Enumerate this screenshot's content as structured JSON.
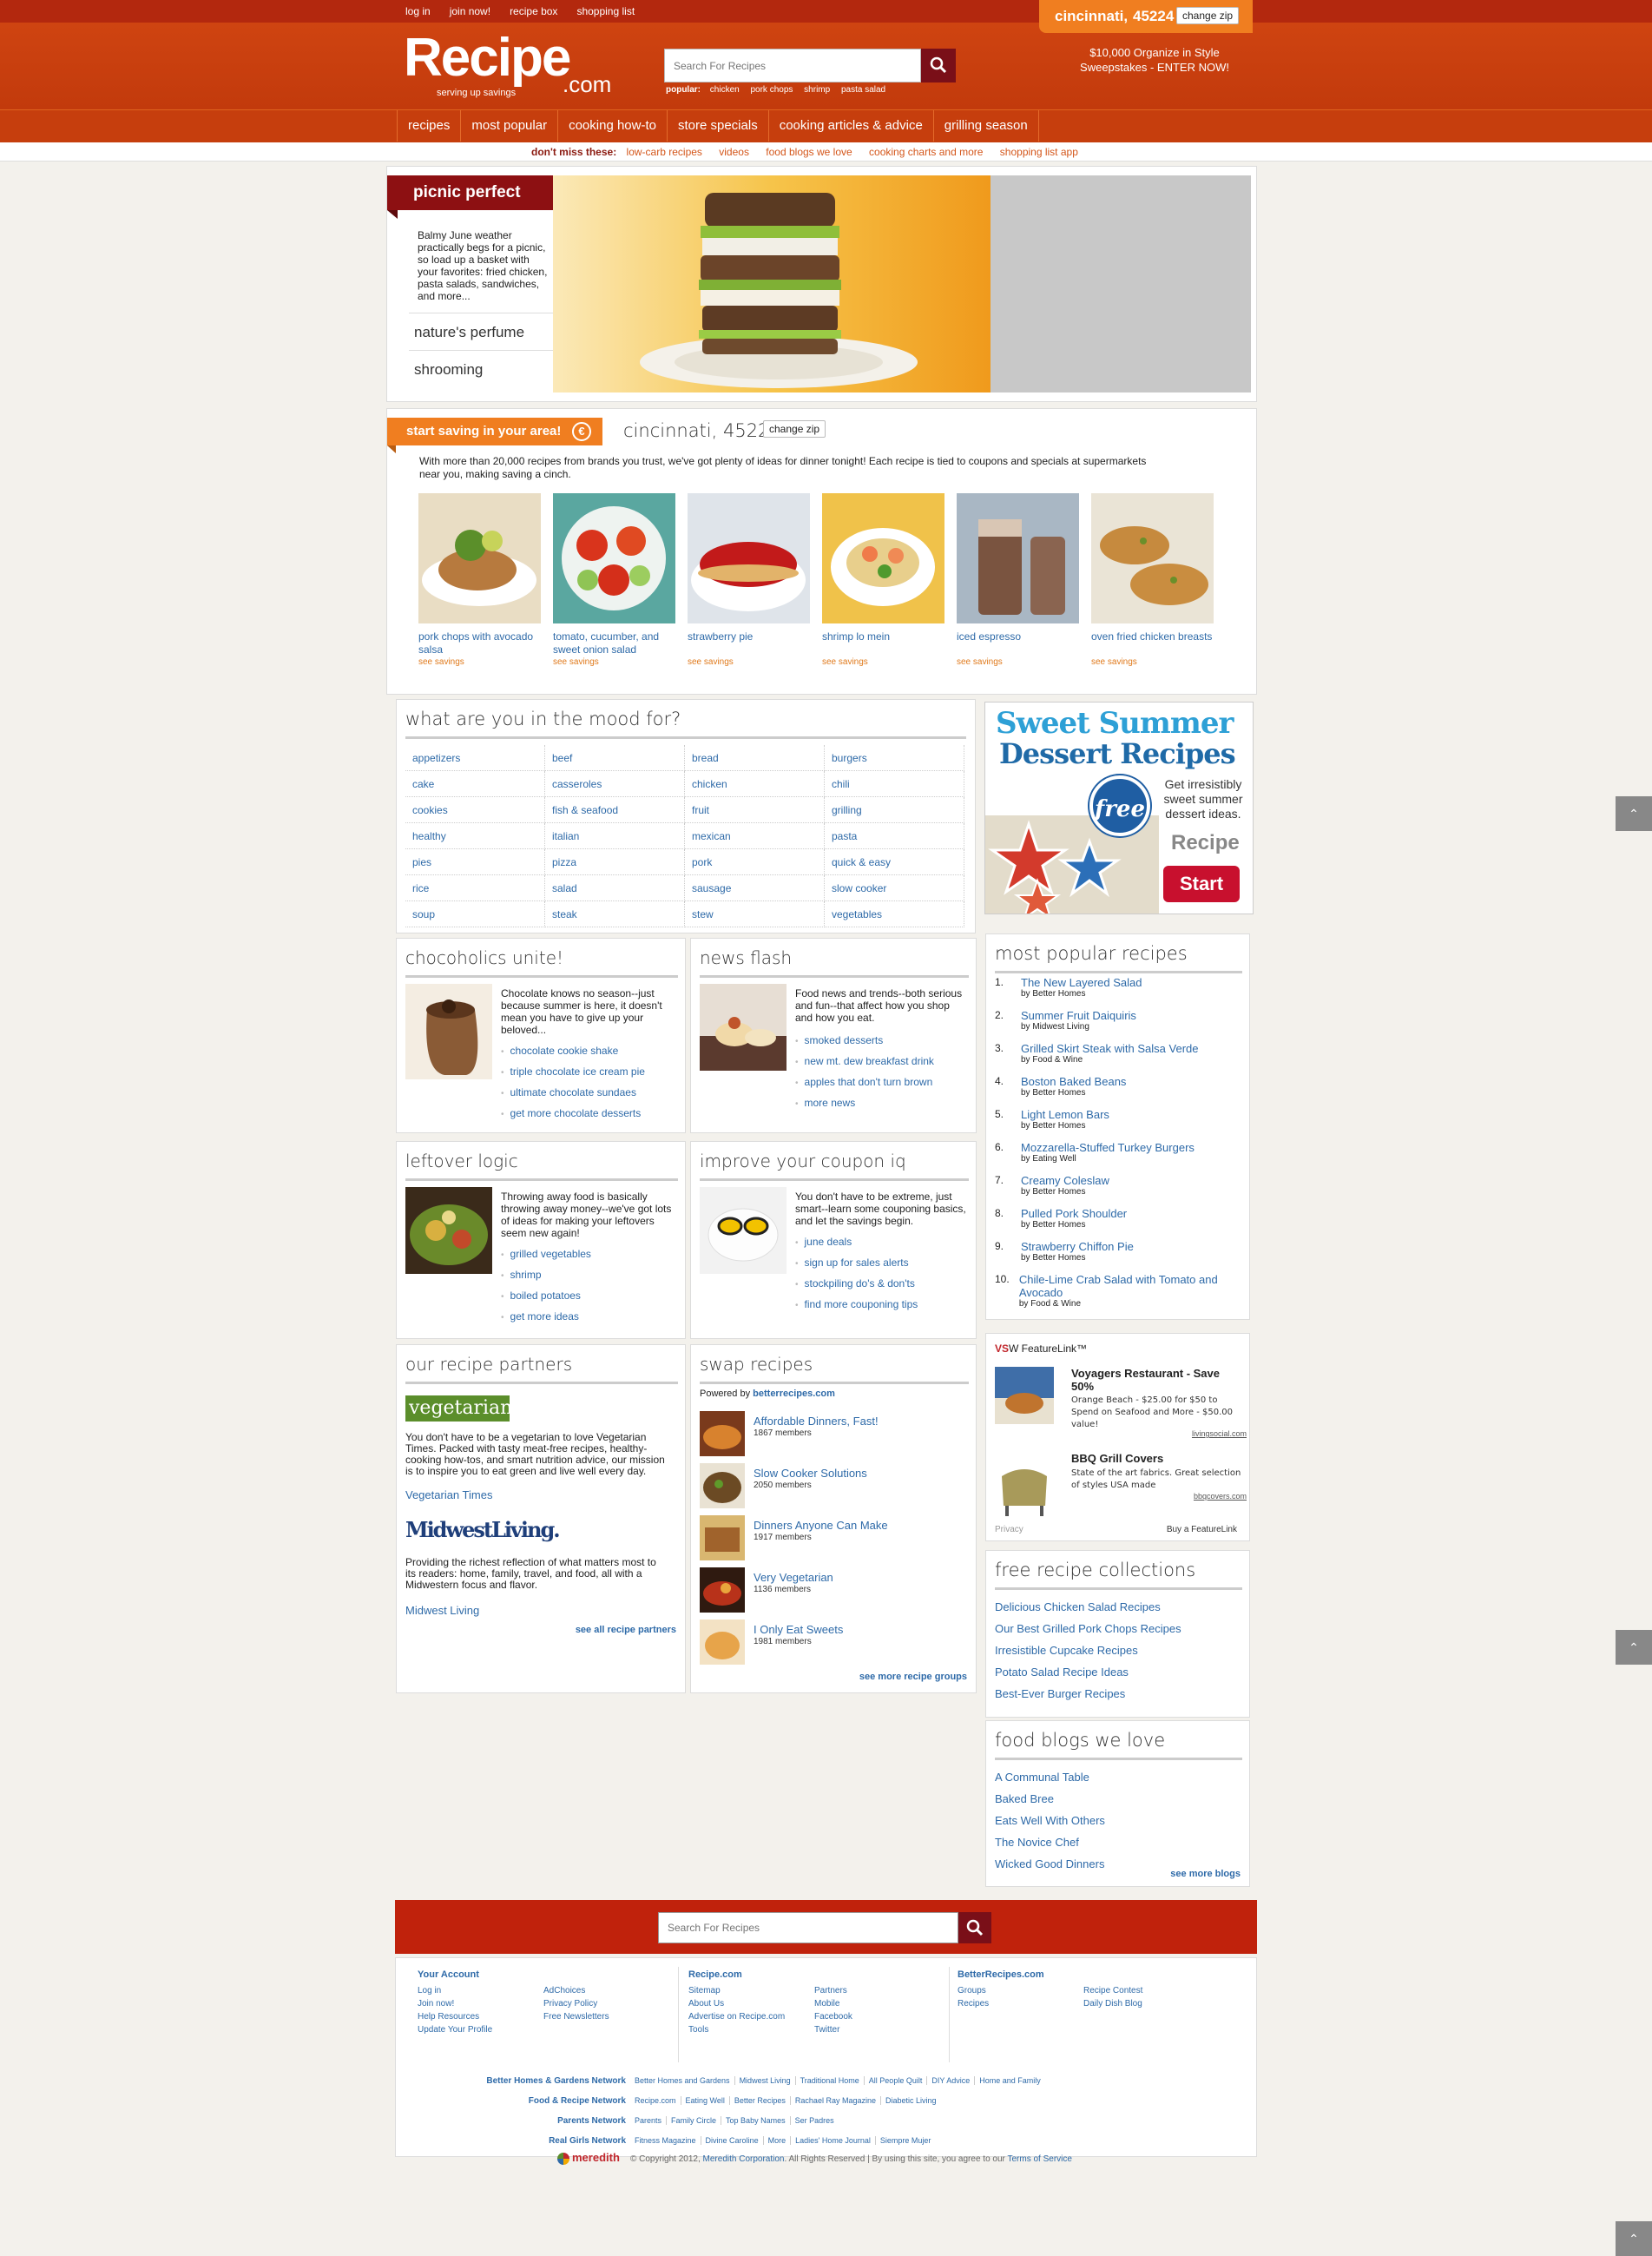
{
  "topnav": [
    "log in",
    "join now!",
    "recipe box",
    "shopping list"
  ],
  "zip": {
    "city": "cincinnati,",
    "code": "45224",
    "change": "change zip"
  },
  "logo": {
    "name": "Recipe",
    "dotcom": ".com",
    "tagline": "serving up savings"
  },
  "search": {
    "placeholder": "Search For Recipes",
    "popular_label": "popular:",
    "popular": [
      "chicken",
      "pork chops",
      "shrimp",
      "pasta salad"
    ]
  },
  "sweeps": {
    "line1": "$10,000 Organize in Style",
    "line2": "Sweepstakes - ENTER NOW!"
  },
  "mainnav": [
    "recipes",
    "most popular",
    "cooking how-to",
    "store specials",
    "cooking articles & advice",
    "grilling season"
  ],
  "dontmiss": {
    "label": "don't miss these:",
    "links": [
      "low-carb recipes",
      "videos",
      "food blogs we love",
      "cooking charts and more",
      "shopping list app"
    ]
  },
  "picnic": {
    "tab": "picnic perfect",
    "text": "Balmy June weather practically begs for a picnic, so load up a basket with your favorites: fried chicken, pasta salads, sandwiches, and more...",
    "links": [
      "nature's perfume",
      "shrooming"
    ]
  },
  "saving": {
    "tab": "start saving in your area!",
    "city": "cincinnati, 45224",
    "change": "change zip",
    "intro": "With more than 20,000 recipes from brands you trust, we've got plenty of ideas for dinner tonight! Each recipe is tied to coupons and specials at supermarkets near you, making saving a cinch.",
    "savings_label": "see savings",
    "recipes": [
      "pork chops with avocado salsa",
      "tomato, cucumber, and sweet onion salad",
      "strawberry pie",
      "shrimp lo mein",
      "iced espresso",
      "oven fried chicken breasts"
    ]
  },
  "mood": {
    "title": "what are you in the mood for?",
    "items": [
      "appetizers",
      "beef",
      "bread",
      "burgers",
      "cake",
      "casseroles",
      "chicken",
      "chili",
      "cookies",
      "fish & seafood",
      "fruit",
      "grilling",
      "healthy",
      "italian",
      "mexican",
      "pasta",
      "pies",
      "pizza",
      "pork",
      "quick & easy",
      "rice",
      "salad",
      "sausage",
      "slow cooker",
      "soup",
      "steak",
      "stew",
      "vegetables"
    ]
  },
  "ad": {
    "line1": "Sweet Summer",
    "line2": "Dessert Recipes",
    "free": "free",
    "text": "Get irresistibly sweet summer dessert ideas.",
    "logo": "Recipe",
    "start": "Start"
  },
  "choco": {
    "title": "chocoholics unite!",
    "text": "Chocolate knows no season--just because summer is here, it doesn't mean you have to give up your beloved...",
    "links": [
      "chocolate cookie shake",
      "triple chocolate ice cream pie",
      "ultimate chocolate sundaes",
      "get more chocolate desserts"
    ]
  },
  "news": {
    "title": "news flash",
    "text": "Food news and trends--both serious and fun--that affect how you shop and how you eat.",
    "links": [
      "smoked desserts",
      "new mt. dew breakfast drink",
      "apples that don't turn brown",
      "more news"
    ]
  },
  "leftover": {
    "title": "leftover logic",
    "text": "Throwing away food is basically throwing away money--we've got lots of ideas for making your leftovers seem new again!",
    "links": [
      "grilled vegetables",
      "shrimp",
      "boiled potatoes",
      "get more ideas"
    ]
  },
  "coupon": {
    "title": "improve your coupon iq",
    "text": "You don't have to be extreme, just smart--learn some couponing basics, and let the savings begin.",
    "links": [
      "june deals",
      "sign up for sales alerts",
      "stockpiling do's & don'ts",
      "find more couponing tips"
    ]
  },
  "popular": {
    "title": "most popular recipes",
    "items": [
      {
        "n": "1.",
        "t": "The New Layered Salad",
        "by": "by Better Homes"
      },
      {
        "n": "2.",
        "t": "Summer Fruit Daiquiris",
        "by": "by Midwest Living"
      },
      {
        "n": "3.",
        "t": "Grilled Skirt Steak with Salsa Verde",
        "by": "by Food & Wine"
      },
      {
        "n": "4.",
        "t": "Boston Baked Beans",
        "by": "by Better Homes"
      },
      {
        "n": "5.",
        "t": "Light Lemon Bars",
        "by": "by Better Homes"
      },
      {
        "n": "6.",
        "t": "Mozzarella-Stuffed Turkey Burgers",
        "by": "by Eating Well"
      },
      {
        "n": "7.",
        "t": "Creamy Coleslaw",
        "by": "by Better Homes"
      },
      {
        "n": "8.",
        "t": "Pulled Pork Shoulder",
        "by": "by Better Homes"
      },
      {
        "n": "9.",
        "t": "Strawberry Chiffon Pie",
        "by": "by Better Homes"
      },
      {
        "n": "10.",
        "t": "Chile-Lime Crab Salad with Tomato and Avocado",
        "by": "by Food & Wine"
      }
    ]
  },
  "feature": {
    "brand": "VS",
    "header": "W FeatureLink™",
    "items": [
      {
        "title": "Voyagers Restaurant - Save 50%",
        "desc": "Orange Beach - $25.00 for $50 to Spend on Seafood and More - $50.00 value!",
        "src": "livingsocial.com"
      },
      {
        "title": "BBQ Grill Covers",
        "desc": "State of the art fabrics. Great selection of styles USA made",
        "src": "bbqcovers.com"
      }
    ],
    "privacy": "Privacy",
    "buy": "Buy a FeatureLink"
  },
  "collections": {
    "title": "free recipe collections",
    "items": [
      "Delicious Chicken Salad Recipes",
      "Our Best Grilled Pork Chops Recipes",
      "Irresistible Cupcake Recipes",
      "Potato Salad Recipe Ideas",
      "Best-Ever Burger Recipes"
    ]
  },
  "blogs": {
    "title": "food blogs we love",
    "items": [
      "A Communal Table",
      "Baked Bree",
      "Eats Well With Others",
      "The Novice Chef",
      "Wicked Good Dinners"
    ],
    "more": "see more blogs"
  },
  "partners": {
    "title": "our recipe partners",
    "veg_logo": "vegetarian",
    "veg_text": "You don't have to be a vegetarian to love Vegetarian Times. Packed with tasty meat-free recipes, healthy-cooking how-tos, and smart nutrition advice, our mission is to inspire you to eat green and live well every day.",
    "veg_link": "Vegetarian Times",
    "mw_logo": "MidwestLiving.",
    "mw_text": "Providing the richest reflection of what matters most to its readers: home, family, travel, and food, all with a Midwestern focus and flavor.",
    "mw_link": "Midwest Living",
    "more": "see all recipe partners"
  },
  "swap": {
    "title": "swap recipes",
    "powered": "Powered by",
    "powered_link": "betterrecipes.com",
    "groups": [
      {
        "t": "Affordable Dinners, Fast!",
        "m": "1867 members"
      },
      {
        "t": "Slow Cooker Solutions",
        "m": "2050 members"
      },
      {
        "t": "Dinners Anyone Can Make",
        "m": "1917 members"
      },
      {
        "t": "Very Vegetarian",
        "m": "1136 members"
      },
      {
        "t": "I Only Eat Sweets",
        "m": "1981 members"
      }
    ],
    "more": "see more recipe groups"
  },
  "footer": {
    "search_placeholder": "Search For Recipes",
    "col1": {
      "h": "Your Account",
      "a": [
        "Log in",
        "Join now!",
        "Help Resources",
        "Update Your Profile"
      ],
      "b": [
        "AdChoices",
        "Privacy Policy",
        "Free Newsletters"
      ]
    },
    "col2": {
      "h": "Recipe.com",
      "a": [
        "Sitemap",
        "About Us",
        "Advertise on Recipe.com",
        "Tools"
      ],
      "b": [
        "Partners",
        "Mobile",
        "Facebook",
        "Twitter"
      ]
    },
    "col3": {
      "h": "BetterRecipes.com",
      "a": [
        "Groups",
        "Recipes"
      ],
      "b": [
        "Recipe Contest",
        "Daily Dish Blog"
      ]
    },
    "networks": [
      {
        "label": "Better Homes & Gardens Network",
        "links": [
          "Better Homes and Gardens",
          "Midwest Living",
          "Traditional Home",
          "All People Quilt",
          "DIY Advice",
          "Home and Family"
        ]
      },
      {
        "label": "Food & Recipe Network",
        "links": [
          "Recipe.com",
          "Eating Well",
          "Better Recipes",
          "Rachael Ray Magazine",
          "Diabetic Living"
        ]
      },
      {
        "label": "Parents Network",
        "links": [
          "Parents",
          "Family Circle",
          "Top Baby Names",
          "Ser Padres"
        ]
      },
      {
        "label": "Real Girls Network",
        "links": [
          "Fitness Magazine",
          "Divine Caroline",
          "More",
          "Ladies' Home Journal",
          "Siempre Mujer"
        ]
      }
    ],
    "meredith": "meredith",
    "copyright": "© Copyright 2012,",
    "corp": "Meredith Corporation",
    "rights": ". All Rights Reserved | By using this site, you agree to our",
    "terms": "Terms of Service"
  }
}
